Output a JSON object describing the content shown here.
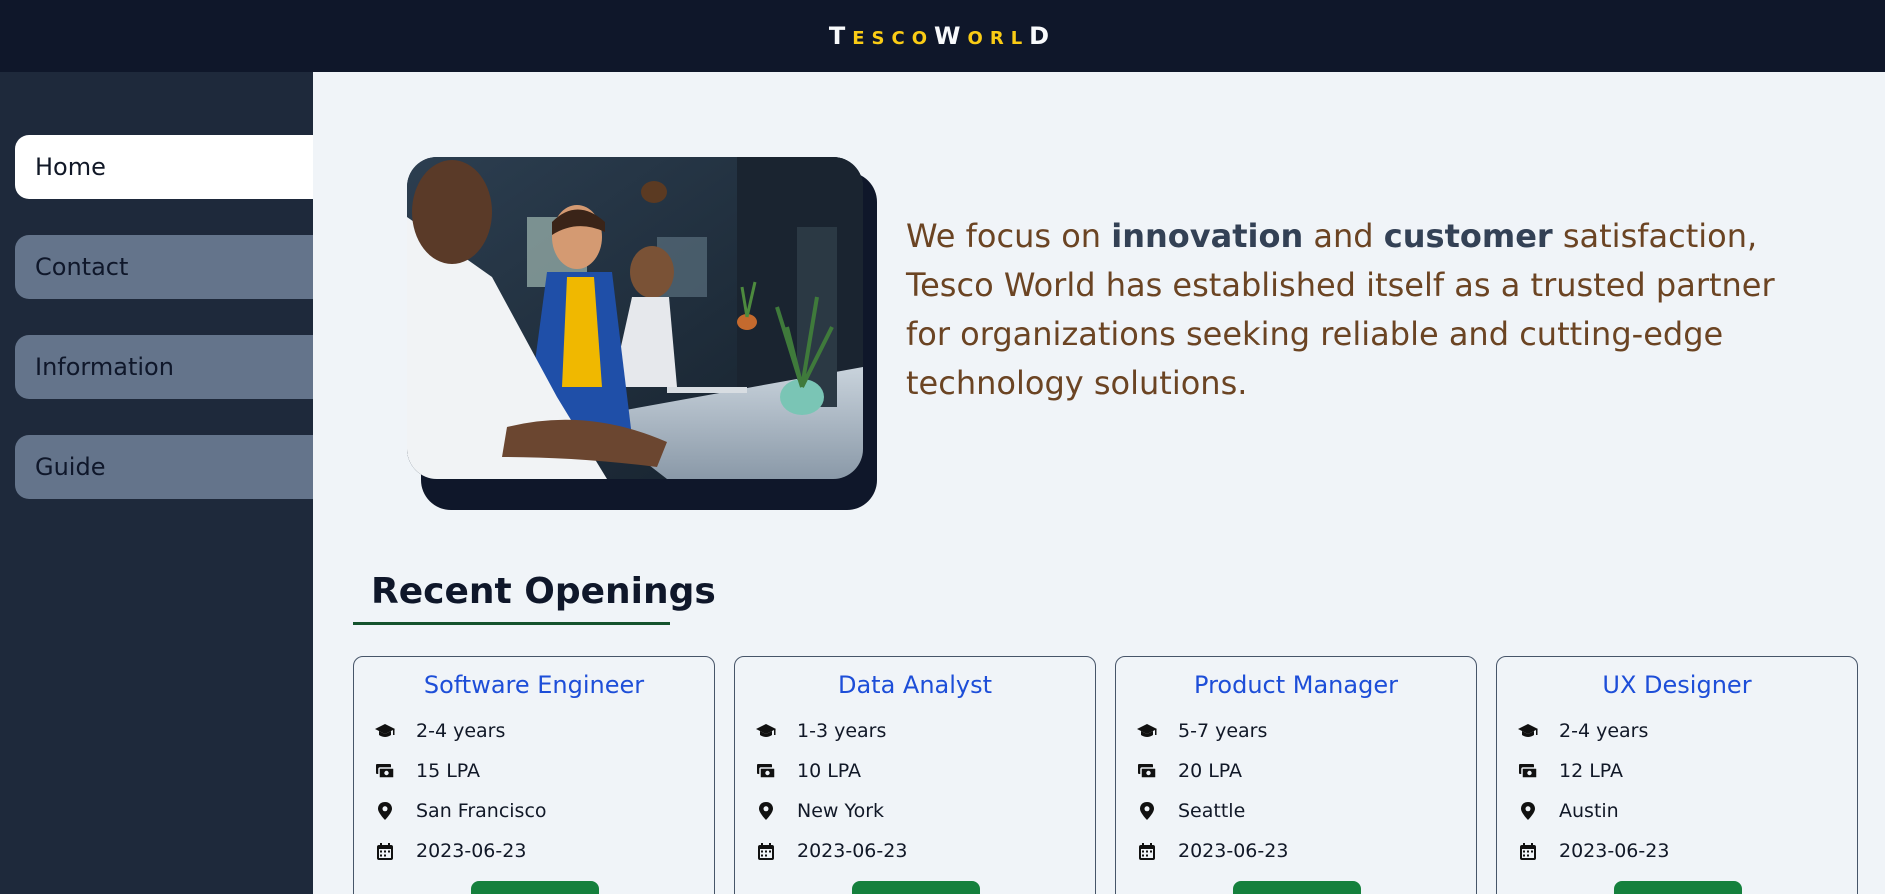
{
  "header": {
    "logo": [
      {
        "t": "T",
        "c": "cap"
      },
      {
        "t": "ESCO",
        "c": "sm"
      },
      {
        "t": "W",
        "c": "cap"
      },
      {
        "t": "ORL",
        "c": "sm"
      },
      {
        "t": "D",
        "c": "cap"
      }
    ],
    "logo_text": "TescoWorld"
  },
  "sidebar": {
    "items": [
      {
        "label": "Home",
        "active": true
      },
      {
        "label": "Contact",
        "active": false
      },
      {
        "label": "Information",
        "active": false
      },
      {
        "label": "Guide",
        "active": false
      }
    ]
  },
  "hero": {
    "text_parts": [
      "We focus on ",
      "innovation",
      " and ",
      "customer",
      " satisfaction, Tesco World has established itself as a trusted partner for organizations seeking reliable and cutting-edge technology solutions."
    ]
  },
  "openings": {
    "title": "Recent Openings",
    "jobs": [
      {
        "title": "Software Engineer",
        "experience": "2-4 years",
        "salary": "15 LPA",
        "location": "San Francisco",
        "date": "2023-06-23"
      },
      {
        "title": "Data Analyst",
        "experience": "1-3 years",
        "salary": "10 LPA",
        "location": "New York",
        "date": "2023-06-23"
      },
      {
        "title": "Product Manager",
        "experience": "5-7 years",
        "salary": "20 LPA",
        "location": "Seattle",
        "date": "2023-06-23"
      },
      {
        "title": "UX Designer",
        "experience": "2-4 years",
        "salary": "12 LPA",
        "location": "Austin",
        "date": "2023-06-23"
      }
    ]
  },
  "icons": {
    "experience": "graduation-cap-icon",
    "salary": "money-icon",
    "location": "map-pin-icon",
    "date": "calendar-icon"
  },
  "colors": {
    "header_bg": "#0f172a",
    "sidebar_bg": "#1e293b",
    "nav_inactive": "#64748b",
    "logo_accent": "#facc15",
    "hero_text": "#6b4423",
    "job_title": "#1d4ed8",
    "apply_button": "#15803d"
  }
}
